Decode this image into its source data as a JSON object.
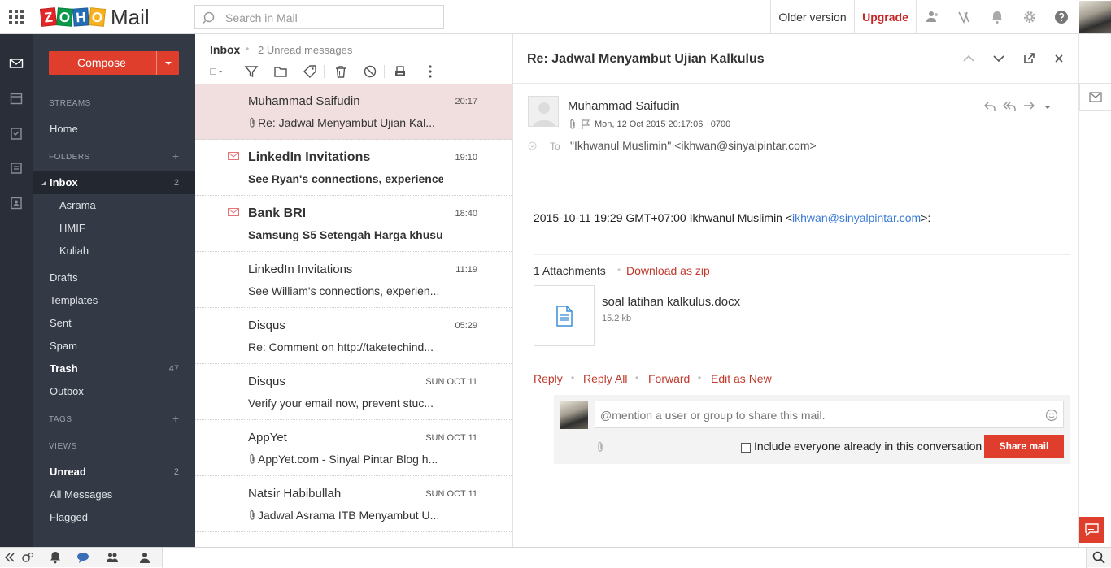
{
  "app": {
    "logo_letters": [
      "Z",
      "O",
      "H",
      "O"
    ],
    "logo_word": "Mail",
    "search_placeholder": "Search in Mail",
    "older_version": "Older version",
    "upgrade": "Upgrade",
    "icons": [
      "apps-grid-icon",
      "search-icon",
      "contacts-icon",
      "signature-icon",
      "notification-bell-icon",
      "settings-gear-icon",
      "help-icon"
    ]
  },
  "sidebar": {
    "compose": "Compose",
    "streams_header": "STREAMS",
    "home": "Home",
    "folders_header": "FOLDERS",
    "folders": [
      {
        "label": "Inbox",
        "count": "2"
      },
      {
        "label": "Asrama"
      },
      {
        "label": "HMIF"
      },
      {
        "label": "Kuliah"
      },
      {
        "label": "Drafts"
      },
      {
        "label": "Templates"
      },
      {
        "label": "Sent"
      },
      {
        "label": "Spam"
      },
      {
        "label": "Trash",
        "count": "47"
      },
      {
        "label": "Outbox"
      }
    ],
    "tags_header": "TAGS",
    "views_header": "VIEWS",
    "views": [
      {
        "label": "Unread",
        "count": "2"
      },
      {
        "label": "All Messages"
      },
      {
        "label": "Flagged"
      }
    ]
  },
  "list": {
    "title": "Inbox",
    "unread_text": "2 Unread messages",
    "messages": [
      {
        "sender": "Muhammad Saifudin",
        "subject": "Re: Jadwal Menyambut Ujian Kal...",
        "time": "20:17",
        "attachment": true,
        "unread": false,
        "selected": true
      },
      {
        "sender": "LinkedIn Invitations",
        "subject": "See Ryan's connections, experience...",
        "time": "19:10",
        "attachment": false,
        "unread": true
      },
      {
        "sender": "Bank BRI",
        "subject": "Samsung S5 Setengah Harga khusu...",
        "time": "18:40",
        "attachment": false,
        "unread": true
      },
      {
        "sender": "LinkedIn Invitations",
        "subject": "See William's connections, experien...",
        "time": "11:19",
        "attachment": false,
        "unread": false
      },
      {
        "sender": "Disqus",
        "subject": "Re: Comment on http://taketechind...",
        "time": "05:29",
        "attachment": false,
        "unread": false
      },
      {
        "sender": "Disqus",
        "subject": "Verify your email now, prevent stuc...",
        "time": "SUN OCT 11",
        "attachment": false,
        "unread": false
      },
      {
        "sender": "AppYet",
        "subject": "AppYet.com - Sinyal Pintar Blog h...",
        "time": "SUN OCT 11",
        "attachment": true,
        "unread": false
      },
      {
        "sender": "Natsir Habibullah",
        "subject": "Jadwal Asrama ITB Menyambut U...",
        "time": "SUN OCT 11",
        "attachment": true,
        "unread": false
      }
    ]
  },
  "reader": {
    "subject": "Re: Jadwal Menyambut Ujian Kalkulus",
    "sender_name": "Muhammad Saifudin",
    "date": "Mon, 12 Oct 2015 20:17:06 +0700",
    "to_label": "To",
    "to_value": "\"Ikhwanul Muslimin\" <ikhwan@sinyalpintar.com>",
    "body_prefix": "2015-10-11 19:29 GMT+07:00 Ikhwanul Muslimin <",
    "body_link": "ikhwan@sinyalpintar.com",
    "body_suffix": ">:",
    "attachments_count": "1 Attachments",
    "download_zip": "Download as zip",
    "attachment_name": "soal latihan kalkulus.docx",
    "attachment_size": "15.2 kb",
    "actions": [
      "Reply",
      "Reply All",
      "Forward",
      "Edit as New"
    ],
    "mention_placeholder": "@mention a user or group to share this mail.",
    "include_label": "Include everyone already in this conversation",
    "share_button": "Share mail"
  },
  "colors": {
    "accent": "#e03e2d",
    "sidebar_bg": "#333a45",
    "rail_bg": "#2a2e38",
    "selected_row": "#f1dede",
    "link": "#3a7bd5"
  }
}
